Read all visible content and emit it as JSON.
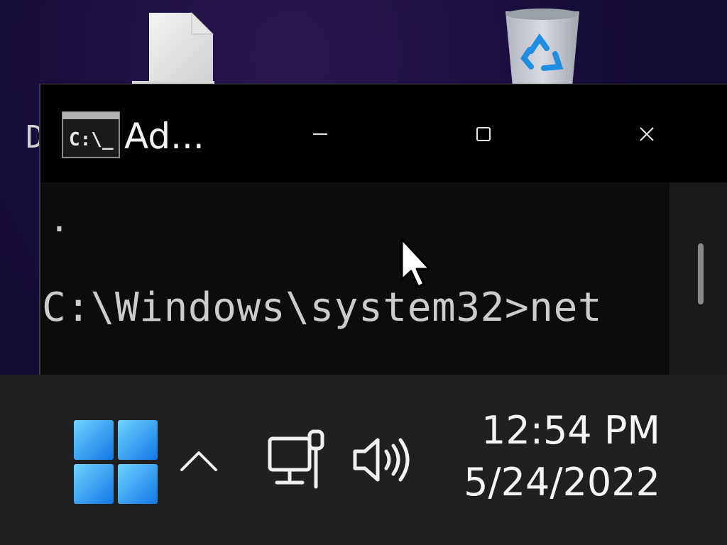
{
  "desktop": {
    "file_icon": "document-icon",
    "recycle_icon": "recycle-bin-icon",
    "peek_label": "D"
  },
  "window": {
    "title": "Ad...",
    "app_icon": "command-prompt-icon",
    "minimize_icon": "minimize-icon",
    "maximize_icon": "maximize-icon",
    "close_icon": "close-icon"
  },
  "console": {
    "line1": ".",
    "line2": "C:\\Windows\\system32>net"
  },
  "taskbar": {
    "start_icon": "windows-start-icon",
    "chevron_icon": "chevron-up-icon",
    "network_icon": "network-icon",
    "volume_icon": "volume-icon",
    "time": "12:54 PM",
    "date": "5/24/2022"
  },
  "colors": {
    "taskbar_bg": "#202020",
    "titlebar_bg": "#000000",
    "console_bg": "#0c0c0c",
    "console_text": "#cccccc",
    "start_blue": "#2fa8f5"
  }
}
